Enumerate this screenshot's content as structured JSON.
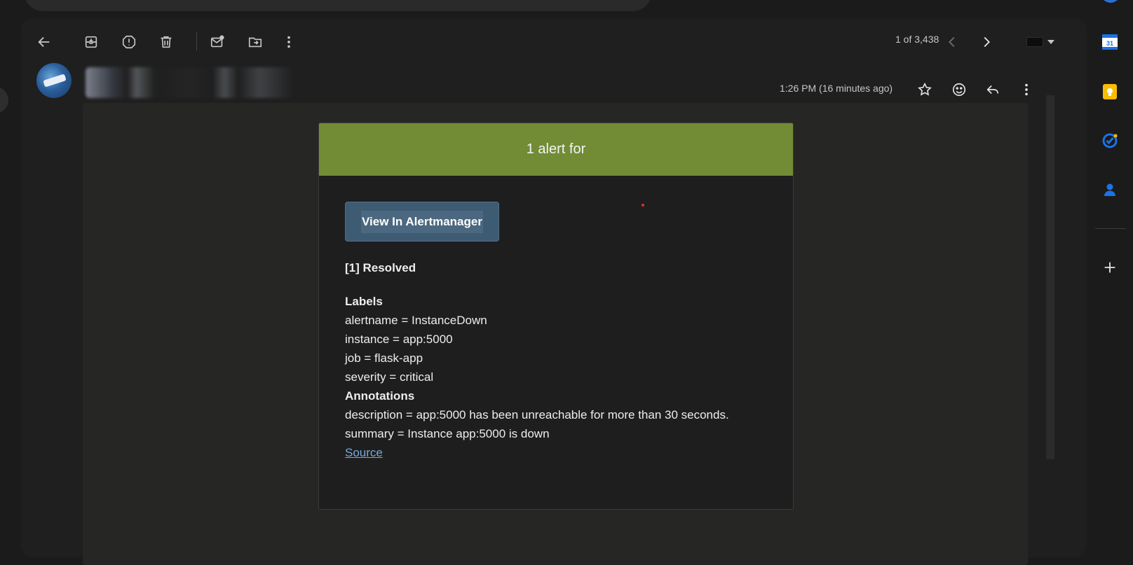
{
  "toolbar": {
    "back_label": "Back",
    "archive_label": "Archive",
    "spam_label": "Report spam",
    "delete_label": "Delete",
    "mark_unread_label": "Mark as unread",
    "move_label": "Move to",
    "more_label": "More",
    "pager": "1 of 3,438"
  },
  "message": {
    "sender_name": "",
    "timestamp": "1:26 PM (16 minutes ago)"
  },
  "alert": {
    "header": "1 alert for",
    "button_label": "View In Alertmanager",
    "status": "[1] Resolved",
    "labels_title": "Labels",
    "labels": [
      "alertname = InstanceDown",
      "instance = app:5000",
      "job = flask-app",
      "severity = critical"
    ],
    "annotations_title": "Annotations",
    "annotations": [
      "description = app:5000 has been unreachable for more than 30 seconds.",
      "summary = Instance app:5000 is down"
    ],
    "source_link": "Source"
  },
  "colors": {
    "alert_header": "#718c35",
    "button_bg": "#3e5b74",
    "link": "#7aa8d6",
    "page_bg": "#1b1b1b"
  },
  "right_rail": {
    "calendar_day": "31",
    "icons": [
      "calendar-icon",
      "keep-icon",
      "tasks-icon",
      "contacts-icon",
      "add-icon"
    ]
  }
}
